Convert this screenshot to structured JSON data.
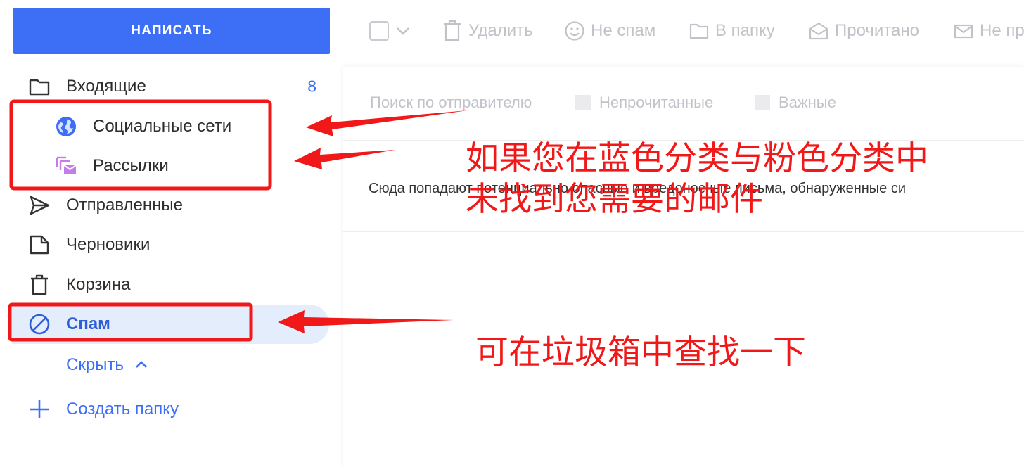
{
  "compose": {
    "label": "НАПИСАТЬ"
  },
  "sidebar": {
    "inbox": {
      "label": "Входящие",
      "count": "8"
    },
    "social": {
      "label": "Социальные сети"
    },
    "newsletters": {
      "label": "Рассылки"
    },
    "sent": {
      "label": "Отправленные"
    },
    "drafts": {
      "label": "Черновики"
    },
    "trash": {
      "label": "Корзина"
    },
    "spam": {
      "label": "Спам"
    },
    "hide": {
      "label": "Скрыть"
    },
    "create_folder": {
      "label": "Создать папку"
    }
  },
  "toolbar": {
    "delete": "Удалить",
    "not_spam": "Не спам",
    "to_folder": "В папку",
    "read": "Прочитано",
    "unread": "Не пр"
  },
  "filters": {
    "sender_placeholder": "Поиск по отправителю",
    "unread": "Непрочитанные",
    "important": "Важные"
  },
  "notice": "Сюда попадают потенциально опасные и вредоносные письма, обнаруженные си",
  "annotations": {
    "line1": "如果您在蓝色分类与粉色分类中",
    "line2": "未找到您需要的邮件",
    "line3": "可在垃圾箱中查找一下"
  },
  "colors": {
    "accent": "#3d6ef6",
    "annotation": "#f01818",
    "active_bg": "#e3edfc",
    "newsletter_icon": "#c47ce8"
  }
}
